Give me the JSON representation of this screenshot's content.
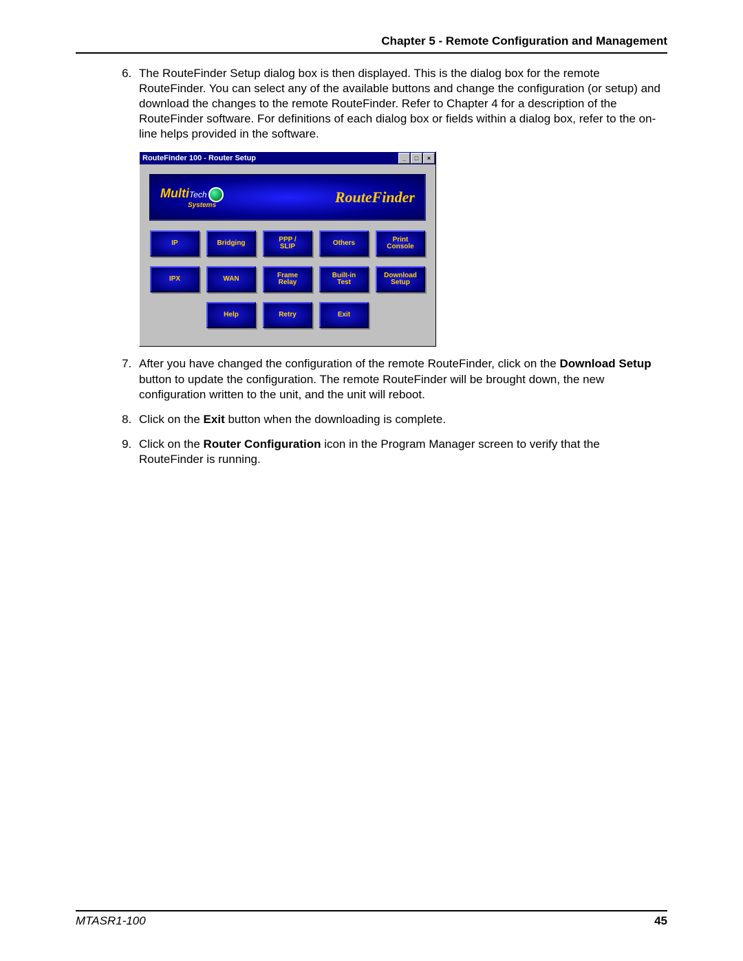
{
  "header": "Chapter 5 - Remote Configuration and Management",
  "footer_left": "MTASR1-100",
  "footer_page": "45",
  "step6_num": "6",
  "step6": "The RouteFinder Setup dialog box is then displayed. This is the dialog box for the remote RouteFinder. You can select any of the available buttons and change the configuration (or setup) and download the changes to the remote RouteFinder. Refer to Chapter 4 for a description of the RouteFinder software. For definitions of each dialog box or fields within a dialog box, refer to the on-line helps provided in the software.",
  "step7_num": "7",
  "step7_a": "After you have changed the configuration of the remote RouteFinder, click on the ",
  "step7_b": "Download Setup",
  "step7_c": " button to update the configuration. The remote RouteFinder will be brought down, the new configuration written to the unit, and the unit will reboot.",
  "step8_num": "8",
  "step8_a": "Click on the ",
  "step8_b": "Exit",
  "step8_c": " button when the downloading is complete.",
  "step9_num": "9",
  "step9_a": "Click on the ",
  "step9_b": "Router Configuration",
  "step9_c": " icon in the Program Manager screen to verify that the RouteFinder is running.",
  "dlg": {
    "title": "RouteFinder 100 - Router Setup",
    "logo_multi": "Multi",
    "logo_tech": "Tech",
    "logo_systems": "Systems",
    "logo_rf": "RouteFinder",
    "min": "_",
    "max": "□",
    "close": "×",
    "buttons": {
      "r1": [
        "IP",
        "Bridging",
        "PPP /\nSLIP",
        "Others",
        "Print\nConsole"
      ],
      "r2": [
        "IPX",
        "WAN",
        "Frame\nRelay",
        "Built-in\nTest",
        "Download\nSetup"
      ],
      "r3": [
        "Help",
        "Retry",
        "Exit"
      ]
    }
  }
}
